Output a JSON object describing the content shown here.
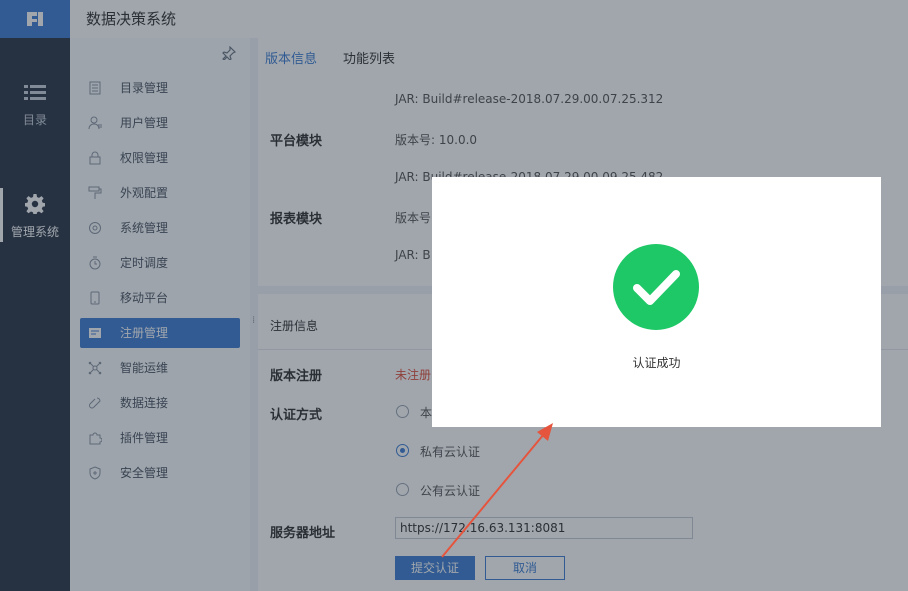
{
  "app": {
    "title": "数据决策系统",
    "logo_icon": "logo-icon"
  },
  "rail": [
    {
      "label": "目录",
      "icon": "list-icon",
      "active": false
    },
    {
      "label": "管理系统",
      "icon": "gear-icon",
      "active": true
    }
  ],
  "submenu": {
    "pin_icon": "pin-icon",
    "items": [
      {
        "label": "目录管理",
        "icon": "catalog-icon"
      },
      {
        "label": "用户管理",
        "icon": "user-icon"
      },
      {
        "label": "权限管理",
        "icon": "lock-icon"
      },
      {
        "label": "外观配置",
        "icon": "paint-roller-icon"
      },
      {
        "label": "系统管理",
        "icon": "settings-icon"
      },
      {
        "label": "定时调度",
        "icon": "timer-icon"
      },
      {
        "label": "移动平台",
        "icon": "mobile-icon"
      },
      {
        "label": "注册管理",
        "icon": "register-icon",
        "active": true
      },
      {
        "label": "智能运维",
        "icon": "network-icon"
      },
      {
        "label": "数据连接",
        "icon": "connection-icon"
      },
      {
        "label": "插件管理",
        "icon": "puzzle-icon"
      },
      {
        "label": "安全管理",
        "icon": "shield-icon"
      }
    ]
  },
  "tabs": [
    {
      "label": "版本信息",
      "active": true
    },
    {
      "label": "功能列表",
      "active": false
    }
  ],
  "version_info": {
    "jar_top": "JAR: Build#release-2018.07.29.00.07.25.312",
    "platform_label": "平台模块",
    "platform_version": "版本号: 10.0.0",
    "jar_mid": "JAR: Build#release-2018.07.29.00.09.25.482",
    "report_label": "报表模块",
    "report_version": "版本号",
    "jar_bottom": "JAR: B"
  },
  "registration": {
    "section_title": "注册信息",
    "version_reg_label": "版本注册",
    "version_reg_status": "未注册",
    "auth_method_label": "认证方式",
    "options": [
      {
        "label": "本",
        "selected": false
      },
      {
        "label": "私有云认证",
        "selected": true
      },
      {
        "label": "公有云认证",
        "selected": false
      }
    ],
    "server_label": "服务器地址",
    "server_value": "https://172.16.63.131:8081",
    "submit_label": "提交认证",
    "cancel_label": "取消"
  },
  "dialog": {
    "message": "认证成功",
    "icon": "check-circle-icon"
  },
  "colors": {
    "accent": "#3e7fd1",
    "success": "#1ec866",
    "rail": "#2b3847",
    "annotation": "#e5553e",
    "warning_text": "#e0503b"
  }
}
